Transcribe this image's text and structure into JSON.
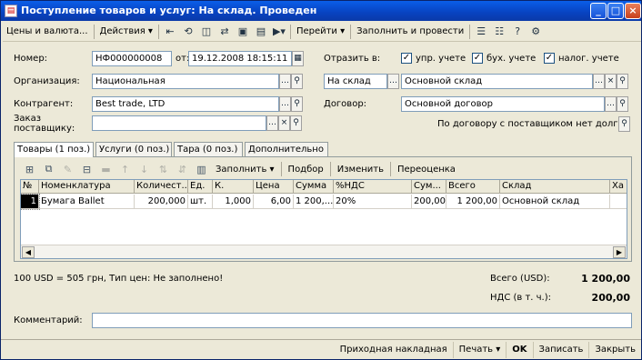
{
  "window": {
    "title": "Поступление товаров и услуг: На склад. Проведен",
    "icon": "document-icon"
  },
  "toolbar": {
    "prices_label": "Цены и валюта...",
    "actions_label": "Действия",
    "goto_label": "Перейти",
    "fill_and_post_label": "Заполнить и провести"
  },
  "form": {
    "number_label": "Номер:",
    "number_value": "НФ000000008",
    "date_label": "от:",
    "date_value": "19.12.2008 18:15:11",
    "org_label": "Организация:",
    "org_value": "Национальная",
    "counterparty_label": "Контрагент:",
    "counterparty_value": "Best trade, LTD",
    "order_label": "Заказ поставщику:",
    "order_value": "",
    "reflect_label": "Отразить в:",
    "check_mgmt_label": "упр. учете",
    "check_mgmt": true,
    "check_acc_label": "бух. учете",
    "check_acc": true,
    "check_tax_label": "налог. учете",
    "check_tax": true,
    "warehouse_type_value": "На склад",
    "warehouse_value": "Основной склад",
    "contract_label": "Договор:",
    "contract_value": "Основной договор",
    "contract_debt_text": "По договору с поставщиком нет долга"
  },
  "tabs": [
    {
      "label": "Товары (1 поз.)"
    },
    {
      "label": "Услуги (0 поз.)"
    },
    {
      "label": "Тара (0 поз.)"
    },
    {
      "label": "Дополнительно"
    }
  ],
  "panel_toolbar": {
    "fill_label": "Заполнить",
    "selection_label": "Подбор",
    "change_label": "Изменить",
    "revalue_label": "Переоценка"
  },
  "table": {
    "headers": [
      "№",
      "Номенклатура",
      "Количест...",
      "Ед.",
      "К.",
      "Цена",
      "Сумма",
      "%НДС",
      "Сум...",
      "Всего",
      "Склад",
      "Ха"
    ],
    "rows": [
      [
        "1",
        "Бумага Ballet",
        "200,000",
        "шт.",
        "1,000",
        "6,00",
        "1 200,...",
        "20%",
        "200,00",
        "1 200,00",
        "Основной склад",
        ""
      ]
    ]
  },
  "footer": {
    "currency_note": "100 USD = 505 грн, Тип цен: Не заполнено!",
    "total_label": "Всего (USD):",
    "total_value": "1 200,00",
    "vat_label": "НДС (в т. ч.):",
    "vat_value": "200,00",
    "comment_label": "Комментарий:",
    "comment_value": ""
  },
  "bottom": {
    "invoice_label": "Приходная накладная",
    "print_label": "Печать",
    "ok_label": "OK",
    "save_label": "Записать",
    "close_label": "Закрыть"
  }
}
